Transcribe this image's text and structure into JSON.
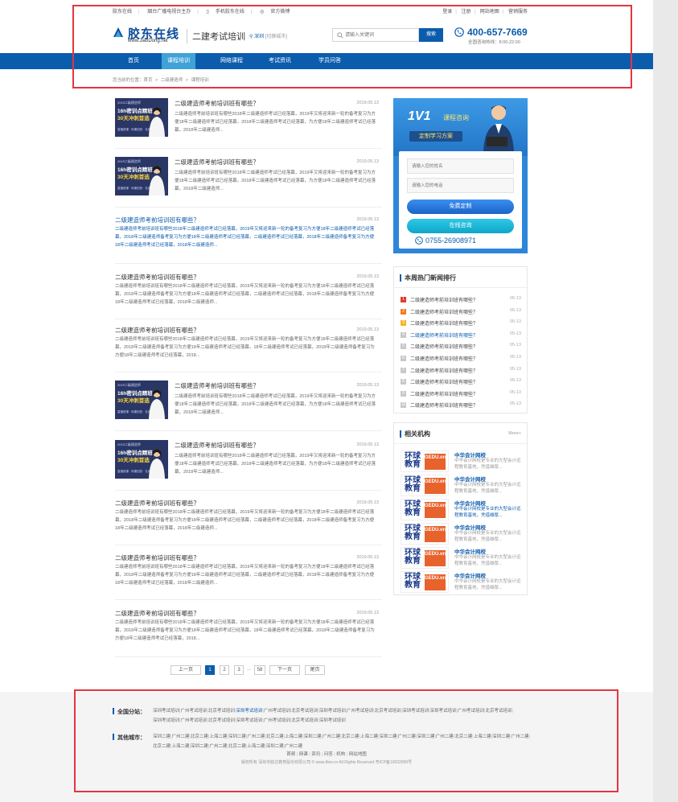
{
  "topbar": {
    "left": [
      "胶东在线",
      "烟台广播电视台主办",
      "手机胶东在线",
      "官方微博"
    ],
    "right": [
      "登录",
      "注册",
      "网站地图",
      "营销服务"
    ]
  },
  "header": {
    "logo_text": "胶东在线",
    "logo_sub": "www.JiaoDong.net",
    "site_title": "二建考试培训",
    "location": "深圳",
    "location_switch": "[切换城市]",
    "search_placeholder": "请输入关键词",
    "search_button": "搜索",
    "phone": "400-657-7669",
    "phone_sub": "全国咨询热线：8:00-22:00"
  },
  "nav": [
    "首页",
    "课程培训",
    "网络课程",
    "考试资讯",
    "学员问答"
  ],
  "nav_active_index": 1,
  "breadcrumb": [
    "您当前的位置：首页",
    ">",
    "二级建造师",
    ">",
    "课程培训"
  ],
  "thumb": {
    "line1": "2019二级建造师",
    "line2": "16h密训点睛班",
    "line3": "30天冲刺首选",
    "line4": "直播授课 · 网课回放 · 名师指导"
  },
  "articles": [
    {
      "title": "二级建造师考前培训班有哪些？",
      "date": "2019.05.13",
      "thumb": true,
      "desc": "二级建造师考前培训班有哪些2018年二级建造师考试已经落幕，2019年又将迎来新一轮的备考复习为方便18年二级建造师考试已经落幕，2018年二级建造师考试已经落幕，为方便18年二级建造师考试已经落幕，2018年二级建造师..."
    },
    {
      "title": "二级建造师考前培训班有哪些？",
      "date": "2019.05.13",
      "thumb": true,
      "desc": "二级建造师考前培训班有哪些2018年二级建造师考试已经落幕，2019年又将迎来新一轮的备考复习为方便18年二级建造师考试已经落幕，2018年二级建造师考试已经落幕，为方便18年二级建造师考试已经落幕，2018年二级建造师..."
    },
    {
      "title": "二级建造师考前培训班有哪些？",
      "date": "2019.05.13",
      "thumb": false,
      "hl": true,
      "desc": "二级建造师考前培训班有哪些2018年二级建造师考试已经落幕，2019年又将迎来新一轮的备考复习为方便18年二级建造师考试已经落幕，2018年二级建造师备考复习为方便18年二级建造师考试已经落幕，二级建造师考试已经落幕，2018年二级建造师备考复习为方便18年二级建造师考试已经落幕，2018年二级建造师..."
    },
    {
      "title": "二级建造师考前培训班有哪些？",
      "date": "2019.05.13",
      "thumb": false,
      "desc": "二级建造师考前培训班有哪些2018年二级建造师考试已经落幕，2019年又将迎来新一轮的备考复习为方便18年二级建造师考试已经落幕，2018年二级建造师备考复习为方便18年二级建造师考试已经落幕，二级建造师考试已经落幕，2018年二级建造师备考复习为方便18年二级建造师考试已经落幕，2018年二级建造师..."
    },
    {
      "title": "二级建造师考前培训班有哪些？",
      "date": "2019.05.13",
      "thumb": false,
      "desc": "二级建造师考前培训班有哪些2018年二级建造师考试已经落幕，2019年又将迎来新一轮的备考复习为方便18年二级建造师考试已经落幕，2018年二级建造师备考复习为方便18年二级建造师考试已经落幕，18年二级建造师考试已经落幕，2018年二级建造师备考复习为方便18年二级建造师考试已经落幕，2018..."
    },
    {
      "title": "二级建造师考前培训班有哪些？",
      "date": "2019.05.13",
      "thumb": true,
      "desc": "二级建造师考前培训班有哪些2018年二级建造师考试已经落幕，2019年又将迎来新一轮的备考复习为方便18年二级建造师考试已经落幕，2018年二级建造师考试已经落幕，为方便18年二级建造师考试已经落幕，2018年二级建造师..."
    },
    {
      "title": "二级建造师考前培训班有哪些？",
      "date": "2019.05.13",
      "thumb": true,
      "desc": "二级建造师考前培训班有哪些2018年二级建造师考试已经落幕，2019年又将迎来新一轮的备考复习为方便18年二级建造师考试已经落幕，2018年二级建造师考试已经落幕，为方便18年二级建造师考试已经落幕，2018年二级建造师..."
    },
    {
      "title": "二级建造师考前培训班有哪些？",
      "date": "2019.05.13",
      "thumb": false,
      "desc": "二级建造师考前培训班有哪些2018年二级建造师考试已经落幕，2019年又将迎来新一轮的备考复习为方便18年二级建造师考试已经落幕，2018年二级建造师备考复习为方便18年二级建造师考试已经落幕，二级建造师考试已经落幕，2018年二级建造师备考复习为方便18年二级建造师考试已经落幕，2018年二级建造师..."
    },
    {
      "title": "二级建造师考前培训班有哪些？",
      "date": "2019.05.13",
      "thumb": false,
      "desc": "二级建造师考前培训班有哪些2018年二级建造师考试已经落幕，2019年又将迎来新一轮的备考复习为方便18年二级建造师考试已经落幕，2018年二级建造师备考复习为方便18年二级建造师考试已经落幕，二级建造师考试已经落幕，2018年二级建造师备考复习为方便18年二级建造师考试已经落幕，2018年二级建造师..."
    },
    {
      "title": "二级建造师考前培训班有哪些？",
      "date": "2019.05.13",
      "thumb": false,
      "desc": "二级建造师考前培训班有哪些2018年二级建造师考试已经落幕，2019年又将迎来新一轮的备考复习为方便18年二级建造师考试已经落幕，2018年二级建造师备考复习为方便18年二级建造师考试已经落幕，18年二级建造师考试已经落幕，2018年二级建造师备考复习为方便18年二级建造师考试已经落幕，2018..."
    }
  ],
  "pagination": {
    "prev": "上一页",
    "pages": [
      "1",
      "2",
      "3"
    ],
    "ellipsis": "...",
    "last_page": "58",
    "next": "下一页",
    "end": "尾页"
  },
  "consult": {
    "hero": "1V1",
    "hero_sub": "课程咨询",
    "tag": "定制学习方案",
    "name_placeholder": "请输入您的姓名",
    "phone_placeholder": "请输入您的电话",
    "btn_custom": "免费定制",
    "btn_online": "在线咨询",
    "tel": "0755-26908971"
  },
  "hot_news": {
    "title": "本周热门新闻排行",
    "items": [
      {
        "n": "1",
        "title": "二级建造师考前培训班有哪些？",
        "date": "05-13"
      },
      {
        "n": "2",
        "title": "二级建造师考前培训班有哪些？",
        "date": "05-13"
      },
      {
        "n": "3",
        "title": "二级建造师考前培训班有哪些？",
        "date": "05-13"
      },
      {
        "n": "4",
        "title": "二级建造师考前培训班有哪些？",
        "date": "05-13",
        "hl": true
      },
      {
        "n": "5",
        "title": "二级建造师考前培训班有哪些？",
        "date": "05-13"
      },
      {
        "n": "6",
        "title": "二级建造师考前培训班有哪些？",
        "date": "05-13"
      },
      {
        "n": "7",
        "title": "二级建造师考前培训班有哪些？",
        "date": "05-13"
      },
      {
        "n": "8",
        "title": "二级建造师考前培训班有哪些？",
        "date": "05-13"
      },
      {
        "n": "9",
        "title": "二级建造师考前培训班有哪些？",
        "date": "05-13"
      },
      {
        "n": "10",
        "title": "二级建造师考前培训班有哪些？",
        "date": "05-13"
      }
    ]
  },
  "orgs": {
    "title": "相关机构",
    "more": "More+",
    "logo_main": "环球教育",
    "logo_badge": "GEDU.org",
    "items": [
      {
        "name": "中华会计网校",
        "desc": "中华会计网校是专业的大型会计远程教育基地，凭借雄厚..."
      },
      {
        "name": "中华会计网校",
        "desc": "中华会计网校是专业的大型会计远程教育基地，凭借雄厚..."
      },
      {
        "name": "中华会计网校",
        "desc": "中华会计网校是专业的大型会计远程教育基地，凭借雄厚...",
        "hl": true
      },
      {
        "name": "中华会计网校",
        "desc": "中华会计网校是专业的大型会计远程教育基地，凭借雄厚..."
      },
      {
        "name": "中华会计网校",
        "desc": "中华会计网校是专业的大型会计远程教育基地，凭借雄厚..."
      },
      {
        "name": "中华会计网校",
        "desc": "中华会计网校是专业的大型会计远程教育基地，凭借雄厚..."
      }
    ]
  },
  "footer": {
    "branches_label": "全国分站：",
    "branches": [
      "深圳考试培训",
      "广州考试培训",
      "北京考试培训",
      "深圳考试培训",
      "广州考试培训",
      "北京考试培训",
      "深圳考试培训",
      "广州考试培训",
      "北京考试培训",
      "深圳考试培训",
      "深圳考试培训",
      "广州考试培训",
      "北京考试培训",
      "深圳考试培训",
      "广州考试培训",
      "北京考试培训",
      "深圳考试培训",
      "广州考试培训",
      "北京考试培训",
      "深圳考试培训"
    ],
    "cities_label": "其他城市：",
    "cities": [
      "深圳二建",
      "广州二建",
      "北京二建",
      "上海二建",
      "深圳二建",
      "广州二建",
      "北京二建",
      "上海二建",
      "深圳二建",
      "广州二建",
      "北京二建",
      "上海二建",
      "深圳二建",
      "广州二建",
      "深圳二建",
      "广州二建",
      "北京二建",
      "上海二建",
      "深圳二建",
      "广州二建",
      "北京二建",
      "上海二建",
      "深圳二建",
      "广州二建",
      "北京二建",
      "上海二建",
      "深圳二建",
      "广州二建"
    ],
    "bottom_links": [
      "首频",
      "网课",
      "资讯",
      "问答",
      "机构",
      "网站地图"
    ],
    "copyright": "版权所有 深圳市胶达教育股份有限公司 © www.tfew.cn All Rights Reserved 粤ICP备10032899号"
  },
  "colors": {
    "primary": "#0b5cad",
    "nav_active": "#3fa2d8",
    "annotation": "#e3353e"
  }
}
